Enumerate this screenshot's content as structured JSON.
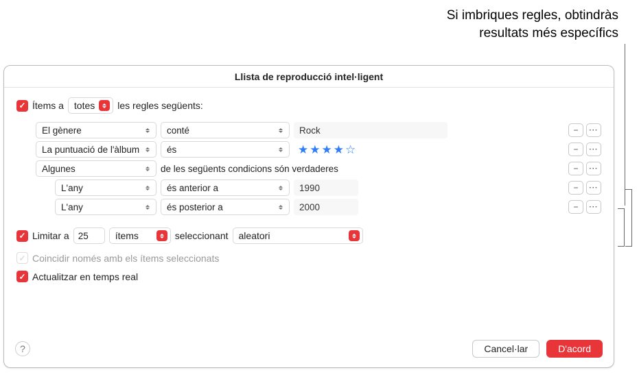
{
  "annotation": {
    "line1": "Si imbriques regles, obtindràs",
    "line2": "resultats més específics"
  },
  "window_title": "Llista de reproducció intel·ligent",
  "match": {
    "prefix": "Ítems a",
    "mode": "totes",
    "suffix": "les regles següents:"
  },
  "rules": [
    {
      "field": "El gènere",
      "op": "conté",
      "value": "Rock",
      "type": "text",
      "indent": 0
    },
    {
      "field": "La puntuació de l'àlbum",
      "op": "és",
      "value": 4,
      "type": "stars",
      "indent": 0
    },
    {
      "field": "Algunes",
      "op_text": "de les següents condicions són verdaderes",
      "type": "group",
      "indent": 0
    },
    {
      "field": "L'any",
      "op": "és anterior a",
      "value": "1990",
      "type": "text",
      "indent": 1
    },
    {
      "field": "L'any",
      "op": "és posterior a",
      "value": "2000",
      "type": "text",
      "indent": 1
    }
  ],
  "limit": {
    "label": "Limitar a",
    "count": "25",
    "unit": "ítems",
    "selecting": "seleccionant",
    "method": "aleatori"
  },
  "match_selected": "Coincidir només amb els ítems seleccionats",
  "live_update": "Actualitzar en temps real",
  "buttons": {
    "cancel": "Cancel·lar",
    "ok": "D'acord"
  }
}
